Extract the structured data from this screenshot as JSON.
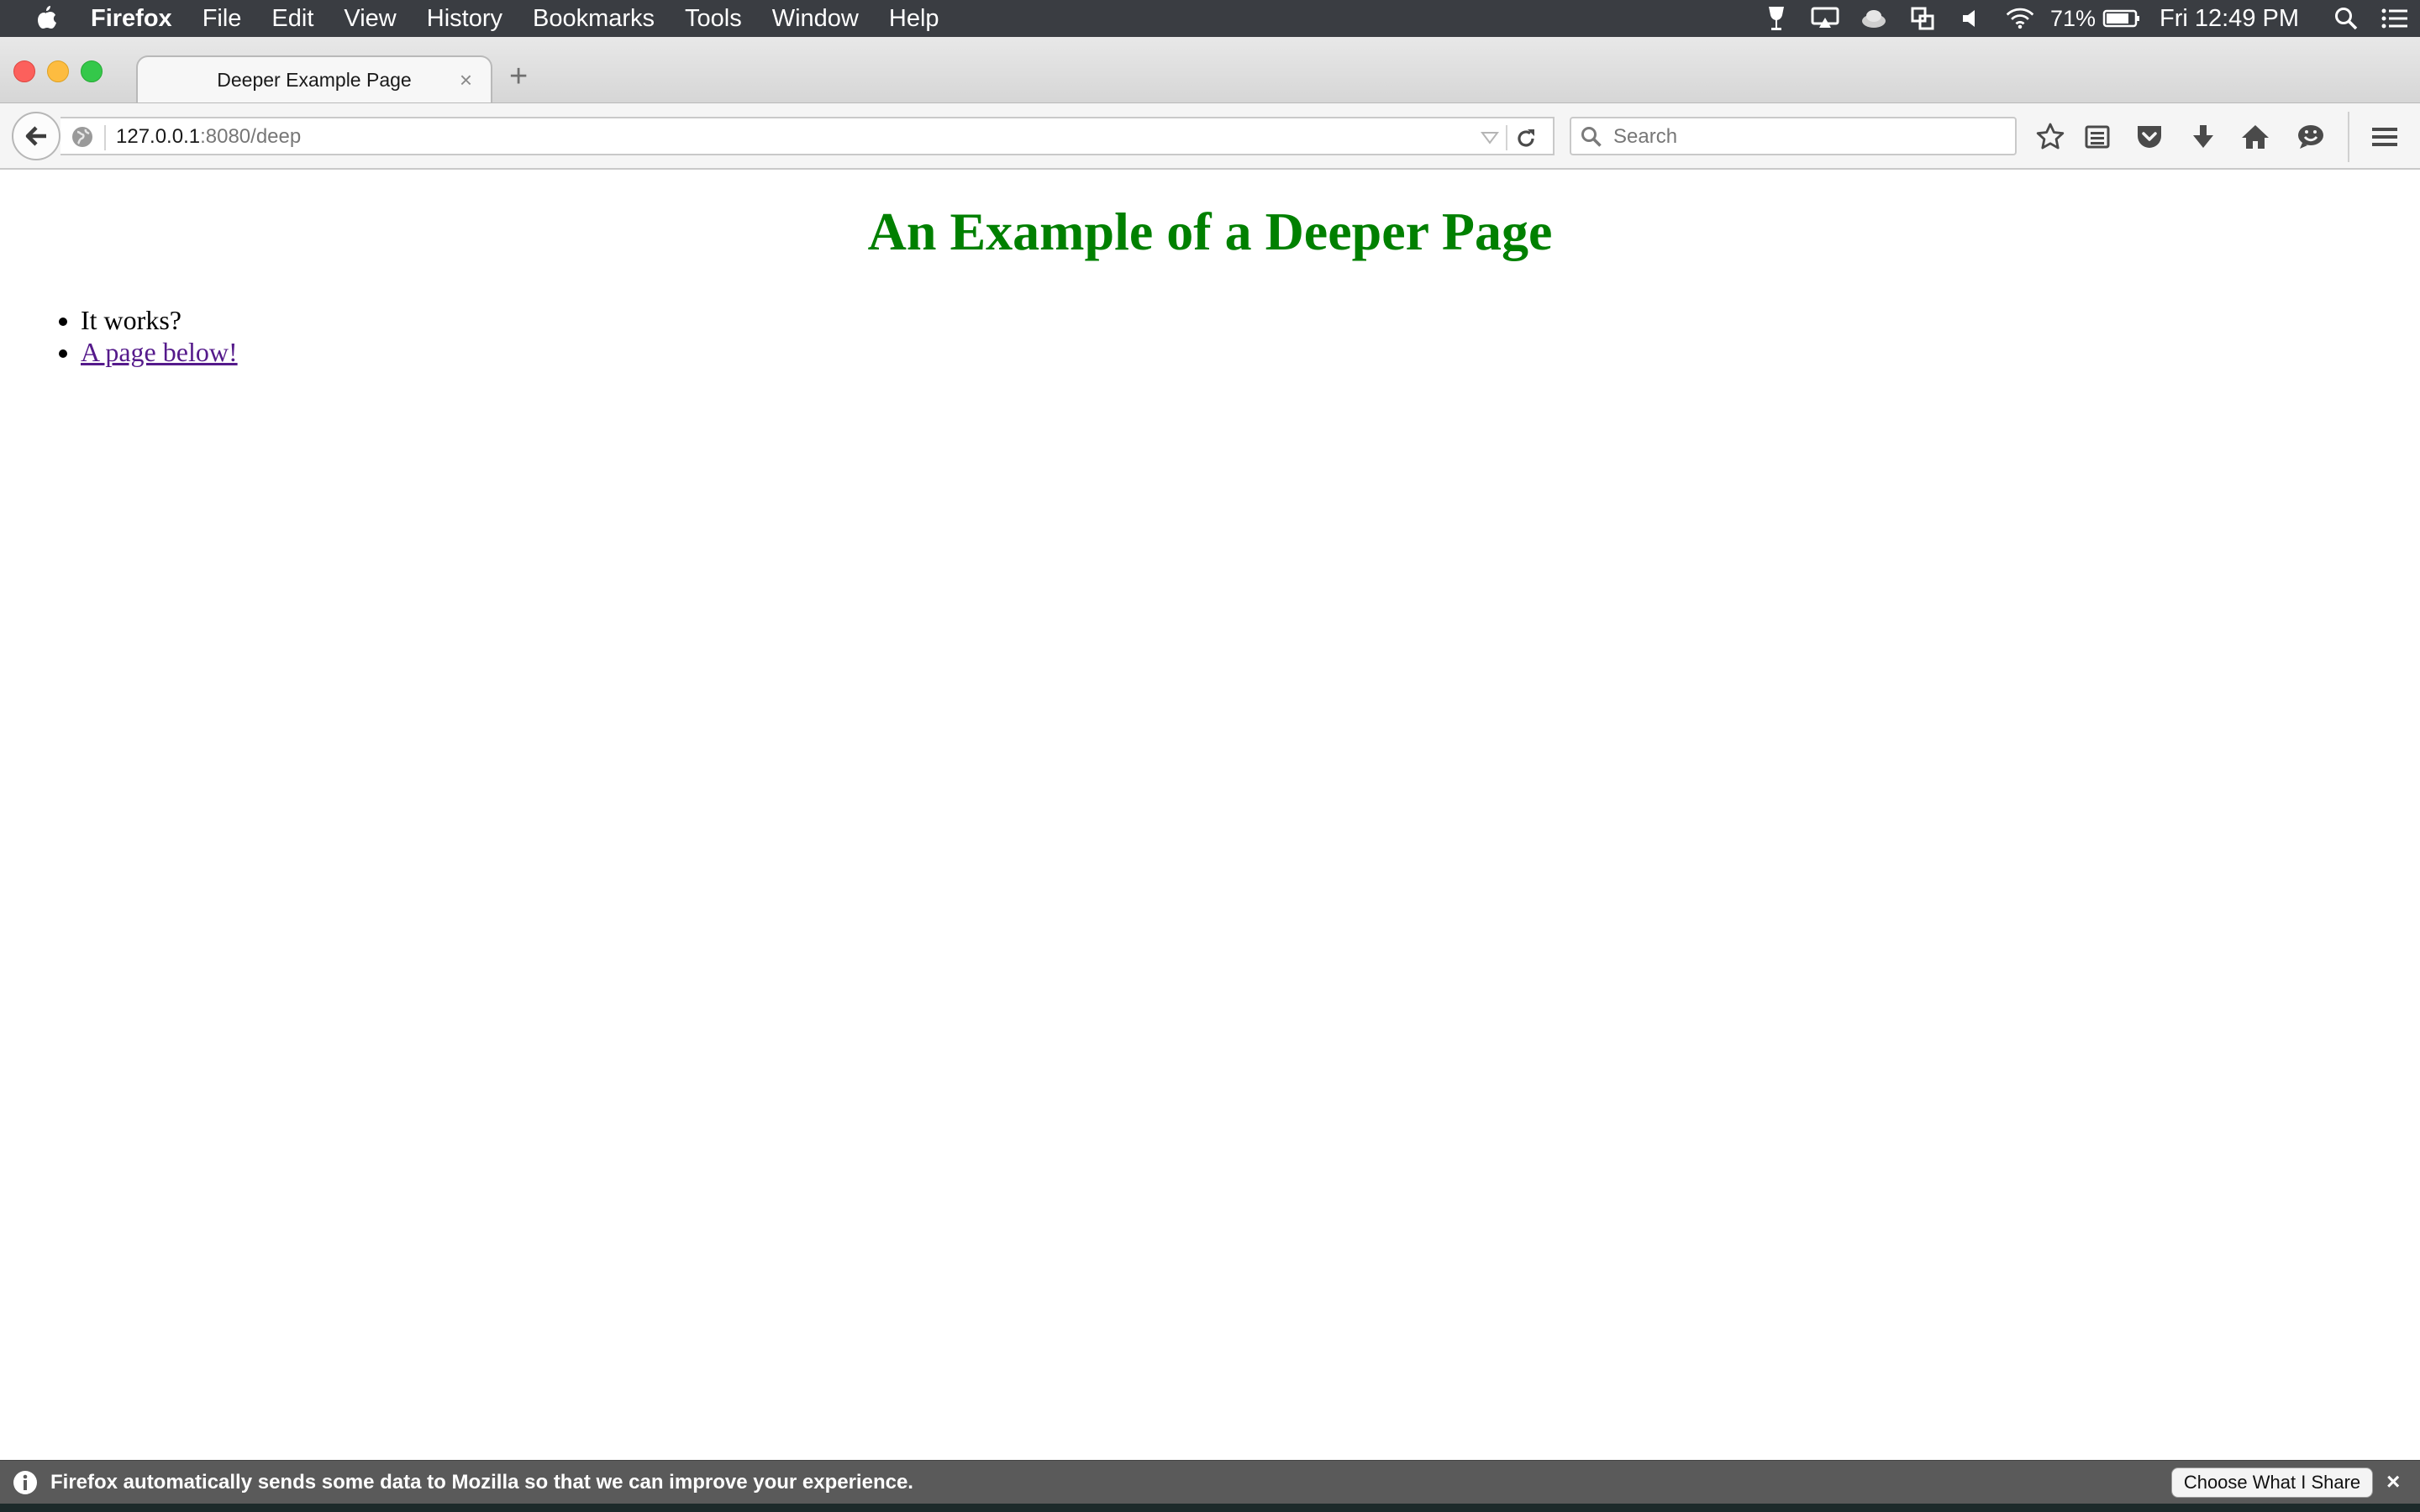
{
  "menubar": {
    "app_name": "Firefox",
    "items": [
      "File",
      "Edit",
      "View",
      "History",
      "Bookmarks",
      "Tools",
      "Window",
      "Help"
    ],
    "battery": "71%",
    "clock": "Fri 12:49 PM",
    "status_icons": [
      "wine-glass-icon",
      "display-icon",
      "cloud-icon",
      "sync-icon",
      "volume-icon",
      "wifi-icon",
      "battery-icon",
      "spotlight-icon",
      "notification-center-icon"
    ]
  },
  "tab": {
    "title": "Deeper Example Page",
    "close": "×"
  },
  "new_tab": "+",
  "urlbar": {
    "host": "127.0.0.1",
    "path": ":8080/deep"
  },
  "search": {
    "placeholder": "Search"
  },
  "page": {
    "heading": "An Example of a Deeper Page",
    "heading_color": "#008000",
    "list": [
      {
        "text": "It works?",
        "link": false
      },
      {
        "text": "A page below!",
        "link": true
      }
    ]
  },
  "notification": {
    "message": "Firefox automatically sends some data to Mozilla so that we can improve your experience.",
    "button": "Choose What I Share",
    "close": "×"
  }
}
